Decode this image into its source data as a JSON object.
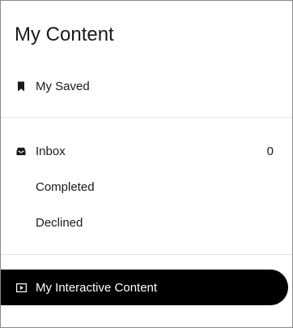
{
  "header": {
    "title": "My Content"
  },
  "menu": {
    "saved": {
      "label": "My Saved",
      "icon": "bookmark-icon"
    },
    "inbox": {
      "label": "Inbox",
      "count": "0",
      "icon": "inbox-icon"
    },
    "completed": {
      "label": "Completed"
    },
    "declined": {
      "label": "Declined"
    },
    "interactive": {
      "label": "My Interactive Content",
      "icon": "play-icon",
      "active": true
    }
  },
  "colors": {
    "active_background": "#000000",
    "active_text": "#ffffff",
    "text": "#1a1a1a",
    "divider": "#e2e2e2",
    "border": "#8a8a8a"
  }
}
